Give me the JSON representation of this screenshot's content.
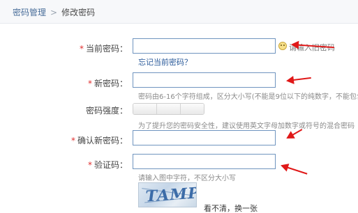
{
  "breadcrumb": {
    "root": "密码管理",
    "separator": ">",
    "current": "修改密码"
  },
  "form": {
    "required_mark": "*",
    "current_password": {
      "label": "当前密码：",
      "value": "",
      "tip": "请输入旧密码",
      "tip_icon": "smiley-icon",
      "forgot_link": "忘记当前密码？"
    },
    "new_password": {
      "label": "新密码：",
      "value": "",
      "hint": "密码由6-16个字符组成，区分大小写(不能是9位以下的纯数字，不能包含空"
    },
    "strength": {
      "label": "密码强度：",
      "segments": [
        "",
        "",
        ""
      ],
      "hint": "为了提升您的密码安全性，建议使用英文字母加数字或符号的混合密码"
    },
    "confirm_password": {
      "label": "确认新密码：",
      "value": ""
    },
    "captcha": {
      "label": "验证码：",
      "value": "",
      "hint": "请输入图中字符，不区分大小写",
      "image_text": "TAMP",
      "refresh_link": "看不清，换一张"
    }
  },
  "annotations": {
    "arrow_color": "#e01818"
  }
}
